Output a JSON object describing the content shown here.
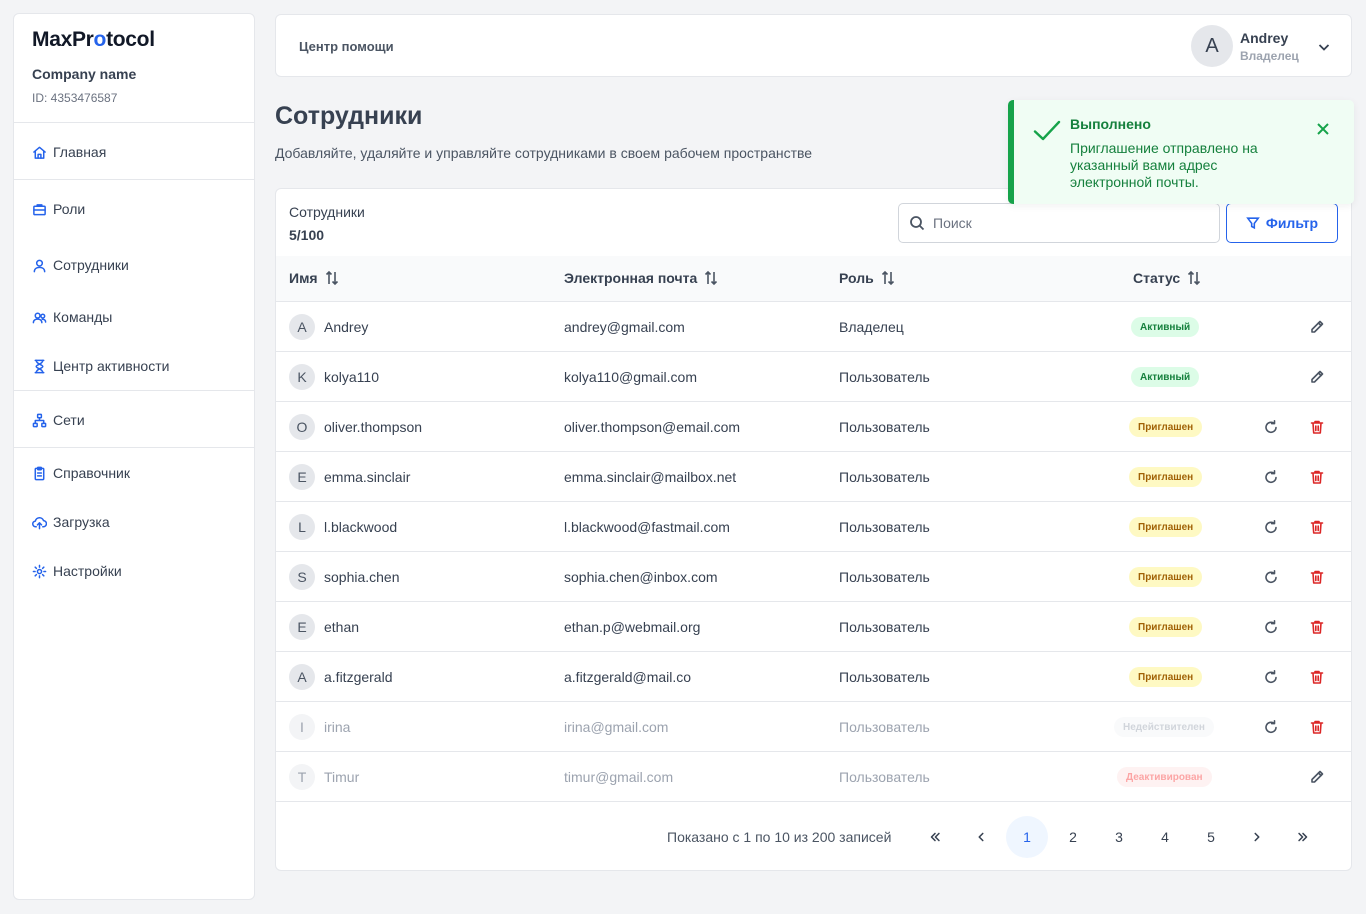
{
  "sidebar": {
    "logo_prefix": "MaxPr",
    "logo_dot": "o",
    "logo_suffix": "tocol",
    "company_name": "Company name",
    "company_id": "ID: 4353476587",
    "items": [
      {
        "label": "Главная",
        "icon": "home-icon"
      },
      {
        "label": "Роли",
        "icon": "briefcase-icon"
      },
      {
        "label": "Сотрудники",
        "icon": "user-icon"
      },
      {
        "label": "Команды",
        "icon": "users-icon"
      },
      {
        "label": "Центр активности",
        "icon": "hourglass-icon"
      },
      {
        "label": "Сети",
        "icon": "network-icon"
      },
      {
        "label": "Справочник",
        "icon": "clipboard-icon"
      },
      {
        "label": "Загрузка",
        "icon": "cloud-upload-icon"
      },
      {
        "label": "Настройки",
        "icon": "gear-icon"
      }
    ]
  },
  "header": {
    "help": "Центр помощи",
    "avatar_letter": "A",
    "user_name": "Andrey",
    "user_role": "Владелец"
  },
  "page": {
    "title": "Сотрудники",
    "subtitle": "Добавляйте, удаляйте и управляйте сотрудниками в своем рабочем пространстве"
  },
  "table": {
    "label": "Сотрудники",
    "count": "5/100",
    "search_placeholder": "Поиск",
    "filter_label": "Фильтр",
    "columns": [
      "Имя",
      "Электронная почта",
      "Роль",
      "Статус"
    ],
    "rows": [
      {
        "initial": "A",
        "name": "Andrey",
        "email": "andrey@gmail.com",
        "role": "Владелец",
        "status": "Активный"
      },
      {
        "initial": "K",
        "name": "kolya110",
        "email": "kolya110@gmail.com",
        "role": "Пользователь",
        "status": "Активный"
      },
      {
        "initial": "O",
        "name": "oliver.thompson",
        "email": "oliver.thompson@email.com",
        "role": "Пользователь",
        "status": "Приглашен"
      },
      {
        "initial": "E",
        "name": "emma.sinclair",
        "email": "emma.sinclair@mailbox.net",
        "role": "Пользователь",
        "status": "Приглашен"
      },
      {
        "initial": "L",
        "name": "l.blackwood",
        "email": "l.blackwood@fastmail.com",
        "role": "Пользователь",
        "status": "Приглашен"
      },
      {
        "initial": "S",
        "name": "sophia.chen",
        "email": "sophia.chen@inbox.com",
        "role": "Пользователь",
        "status": "Приглашен"
      },
      {
        "initial": "E",
        "name": "ethan",
        "email": "ethan.p@webmail.org",
        "role": "Пользователь",
        "status": "Приглашен"
      },
      {
        "initial": "A",
        "name": "a.fitzgerald",
        "email": "a.fitzgerald@mail.co",
        "role": "Пользователь",
        "status": "Приглашен"
      },
      {
        "initial": "I",
        "name": "irina",
        "email": "irina@gmail.com",
        "role": "Пользователь",
        "status": "Недействителен"
      },
      {
        "initial": "T",
        "name": "Timur",
        "email": "timur@gmail.com",
        "role": "Пользователь",
        "status": "Деактивирован"
      }
    ]
  },
  "pagination": {
    "summary": "Показано с 1 по 10 из 200 записей",
    "pages": [
      "1",
      "2",
      "3",
      "4",
      "5"
    ],
    "current": "1"
  },
  "toast": {
    "title": "Выполнено",
    "message": "Приглашение отправлено на указанный вами адрес электронной почты."
  },
  "colors": {
    "accent": "#2563eb",
    "success": "#16a34a",
    "warning_bg": "#fef9c3",
    "danger": "#dc2626"
  }
}
